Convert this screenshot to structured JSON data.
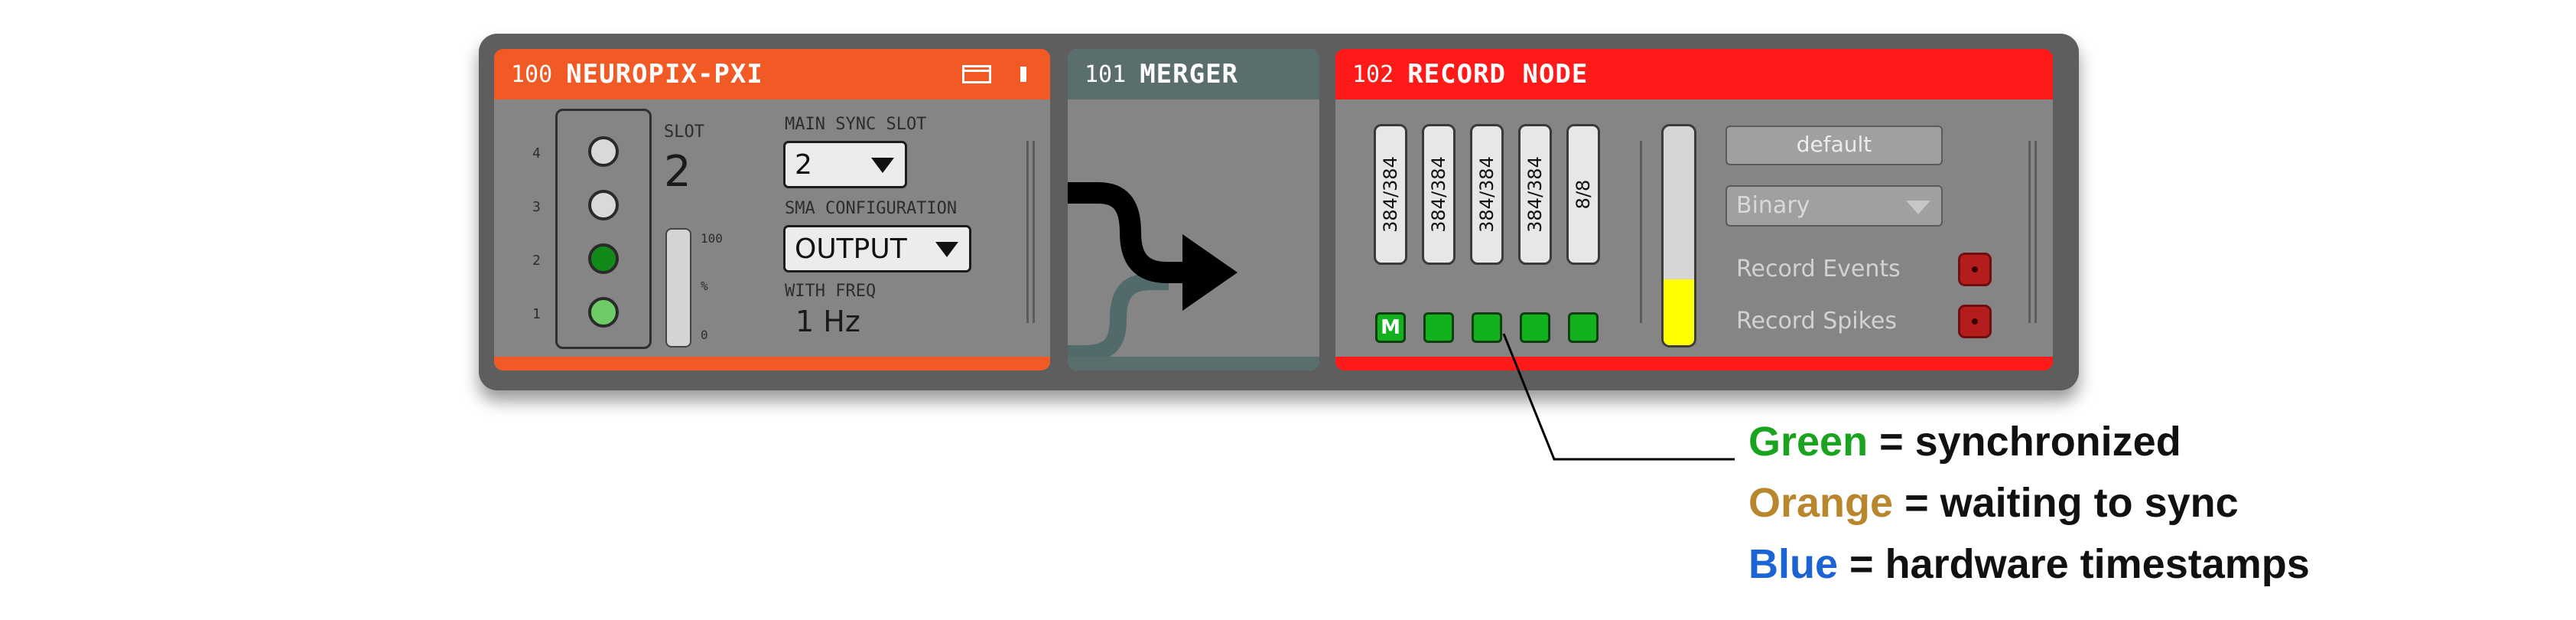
{
  "processors": {
    "neuropix": {
      "id": "100",
      "name": "NEUROPIX-PXI",
      "header_color": "#f15a24",
      "slot_rows": [
        "4",
        "3",
        "2",
        "1"
      ],
      "slot_label": "SLOT",
      "slot_value": "2",
      "fill_scale": [
        "100",
        "%",
        "0"
      ],
      "main_sync_slot_label": "MAIN SYNC SLOT",
      "main_sync_slot_value": "2",
      "sma_configuration_label": "SMA CONFIGURATION",
      "sma_configuration_value": "OUTPUT",
      "with_freq_label": "WITH FREQ",
      "with_freq_value": "1 Hz"
    },
    "merger": {
      "id": "101",
      "name": "MERGER",
      "header_color": "#5a6e6e"
    },
    "record_node": {
      "id": "102",
      "name": "RECORD NODE",
      "header_color": "#ff1a1a",
      "streams": [
        {
          "label": "384/384",
          "sync": "M"
        },
        {
          "label": "384/384",
          "sync": ""
        },
        {
          "label": "384/384",
          "sync": ""
        },
        {
          "label": "384/384",
          "sync": ""
        },
        {
          "label": "8/8",
          "sync": ""
        }
      ],
      "disk_fill": 0.3,
      "directory_button": "default",
      "format_value": "Binary",
      "record_events_label": "Record Events",
      "record_spikes_label": "Record Spikes"
    }
  },
  "legend": {
    "green_word": "Green",
    "green_rest": " = synchronized",
    "orange_word": "Orange",
    "orange_rest": " = waiting to sync",
    "blue_word": "Blue",
    "blue_rest": " = hardware timestamps"
  },
  "colors": {
    "green": "#1aa31f",
    "orange": "#b8862d",
    "blue": "#1c63d6",
    "sync_green": "#12b21f",
    "disk_yellow": "#ffff00"
  },
  "icons": {
    "window": "window-icon",
    "tab": "tab-icon",
    "merge_arrow": "merge-arrow-icon",
    "dropdown": "chevron-down-icon"
  }
}
